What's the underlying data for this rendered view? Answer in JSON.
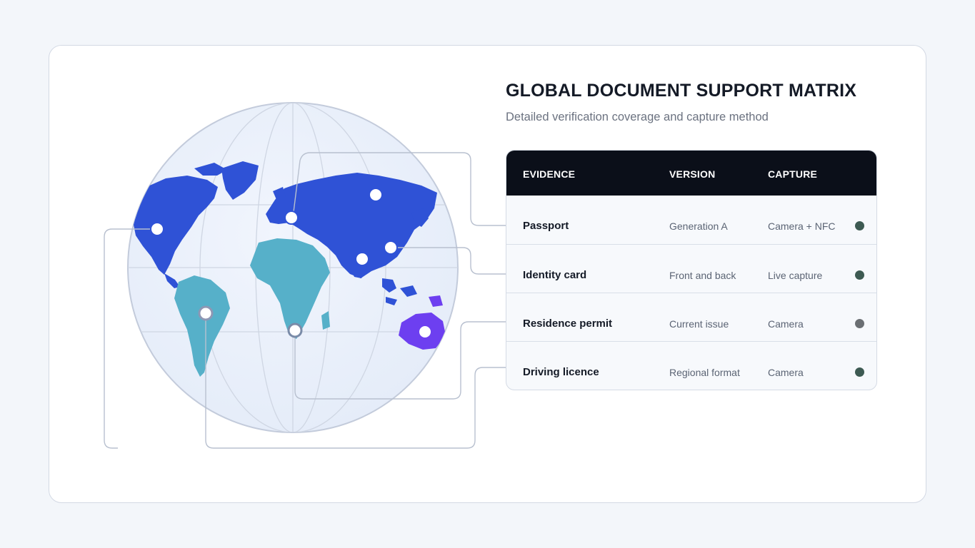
{
  "header": {
    "title": "GLOBAL DOCUMENT SUPPORT MATRIX",
    "subtitle": "Detailed verification coverage and capture method"
  },
  "table": {
    "columns": [
      "EVIDENCE",
      "VERSION",
      "CAPTURE"
    ],
    "rows": [
      {
        "evidence": "Passport",
        "version": "Generation A",
        "capture": "Camera + NFC",
        "status_color": "#3d5a52"
      },
      {
        "evidence": "Identity card",
        "version": "Front and back",
        "capture": "Live capture",
        "status_color": "#3d5a52"
      },
      {
        "evidence": "Residence permit",
        "version": "Current issue",
        "capture": "Camera",
        "status_color": "#6b6f73"
      },
      {
        "evidence": "Driving licence",
        "version": "Regional format",
        "capture": "Camera",
        "status_color": "#3d5a52"
      }
    ]
  },
  "colors": {
    "eurasia_north_america": "#2f52d6",
    "africa_south_america": "#56b0c9",
    "oceania": "#6d3ff0",
    "header_bg": "#0b0f19"
  }
}
